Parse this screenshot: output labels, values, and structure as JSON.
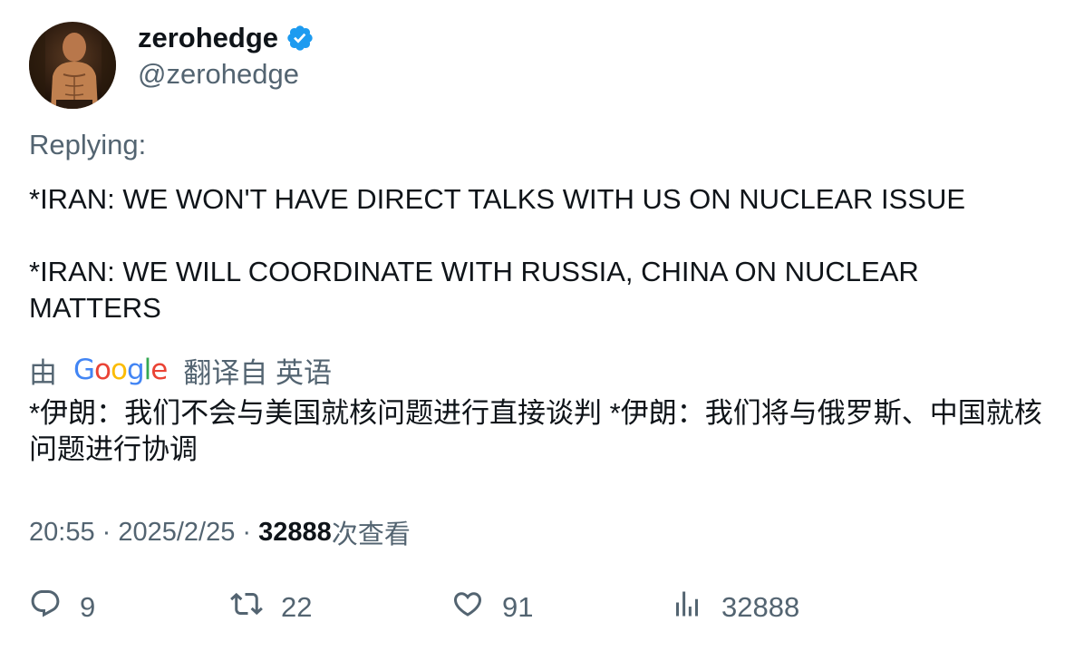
{
  "tweet": {
    "display_name": "zerohedge",
    "handle": "@zerohedge",
    "replying_label": "Replying:",
    "body_lines": [
      "*IRAN: WE WON'T HAVE DIRECT TALKS WITH US ON NUCLEAR ISSUE",
      "*IRAN: WE WILL COORDINATE WITH RUSSIA, CHINA ON NUCLEAR MATTERS"
    ],
    "translation": {
      "prefix": "由",
      "provider": "Google",
      "suffix": "翻译自 英语",
      "text": "*伊朗：我们不会与美国就核问题进行直接谈判 *伊朗：我们将与俄罗斯、中国就核问题进行协调"
    },
    "meta": {
      "time": "20:55",
      "separator1": " · ",
      "date": "2025/2/25",
      "separator2": " · ",
      "views_count": "32888",
      "views_label": "次查看"
    },
    "actions": {
      "replies": "9",
      "retweets": "22",
      "likes": "91",
      "views": "32888"
    },
    "colors": {
      "verified": "#1d9bf0",
      "secondary_text": "#536471",
      "primary_text": "#0f1419"
    },
    "icons": [
      "verified-badge-icon",
      "reply-icon",
      "retweet-icon",
      "like-icon",
      "views-icon"
    ]
  }
}
